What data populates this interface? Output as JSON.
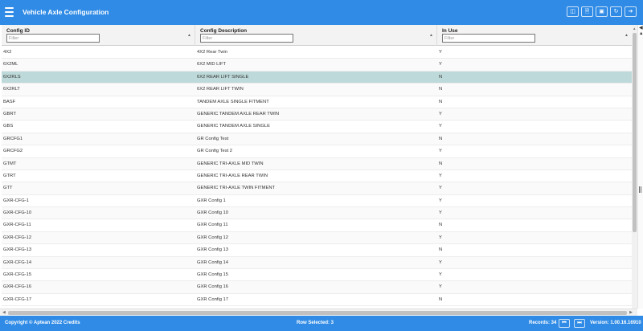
{
  "app": {
    "title": "Vehicle Axle Configuration",
    "toolbar_icons": [
      "view-icon",
      "export-icon",
      "save-icon",
      "refresh-icon",
      "exit-icon"
    ]
  },
  "columns": [
    {
      "label": "Config ID",
      "filter_placeholder": "Filter"
    },
    {
      "label": "Config Description",
      "filter_placeholder": "Filter"
    },
    {
      "label": "In Use",
      "filter_placeholder": "Filter"
    }
  ],
  "rows": [
    {
      "id": "4X2",
      "desc": "4X2 Rear Twin",
      "in_use": "Y"
    },
    {
      "id": "6X2ML",
      "desc": "6X2 MID LIFT",
      "in_use": "Y"
    },
    {
      "id": "6X2RLS",
      "desc": "6X2 REAR LIFT SINGLE",
      "in_use": "N",
      "selected": true
    },
    {
      "id": "6X2RLT",
      "desc": "6X2 REAR LIFT TWIN",
      "in_use": "N"
    },
    {
      "id": "BASF",
      "desc": "TANDEM AXLE SINGLE FITMENT",
      "in_use": "N"
    },
    {
      "id": "GBRT",
      "desc": "GENERIC TANDEM AXLE REAR TWIN",
      "in_use": "Y"
    },
    {
      "id": "GBS",
      "desc": "GENERIC TANDEM AXLE SINGLE",
      "in_use": "Y"
    },
    {
      "id": "GRCFG1",
      "desc": "GR Config Test",
      "in_use": "N"
    },
    {
      "id": "GRCFG2",
      "desc": "GR Config Test 2",
      "in_use": "Y"
    },
    {
      "id": "GTMT",
      "desc": "GENERIC TRI-AXLE MID TWIN",
      "in_use": "N"
    },
    {
      "id": "GTRT",
      "desc": "GENERIC TRI-AXLE REAR TWIN",
      "in_use": "Y"
    },
    {
      "id": "GTT",
      "desc": "GENERIC TRI-AXLE TWIN FITMENT",
      "in_use": "Y"
    },
    {
      "id": "GXR-CFG-1",
      "desc": "GXR Config 1",
      "in_use": "Y"
    },
    {
      "id": "GXR-CFG-10",
      "desc": "GXR Config 10",
      "in_use": "Y"
    },
    {
      "id": "GXR-CFG-11",
      "desc": "GXR Config 11",
      "in_use": "N"
    },
    {
      "id": "GXR-CFG-12",
      "desc": "GXR Config 12",
      "in_use": "Y"
    },
    {
      "id": "GXR-CFG-13",
      "desc": "GXR Config 13",
      "in_use": "N"
    },
    {
      "id": "GXR-CFG-14",
      "desc": "GXR Config 14",
      "in_use": "Y"
    },
    {
      "id": "GXR-CFG-15",
      "desc": "GXR Config 15",
      "in_use": "Y"
    },
    {
      "id": "GXR-CFG-16",
      "desc": "GXR Config 16",
      "in_use": "Y"
    },
    {
      "id": "GXR-CFG-17",
      "desc": "GXR Config 17",
      "in_use": "N"
    }
  ],
  "footer": {
    "copyright": "Copyright © Aptean 2022 Credits",
    "row_selected": "Row Selected: 3",
    "records": "Records: 34",
    "version": "Version: 1.00.16.16910"
  },
  "colors": {
    "brand": "#2f8be6",
    "selected_row": "#bed9d9"
  }
}
